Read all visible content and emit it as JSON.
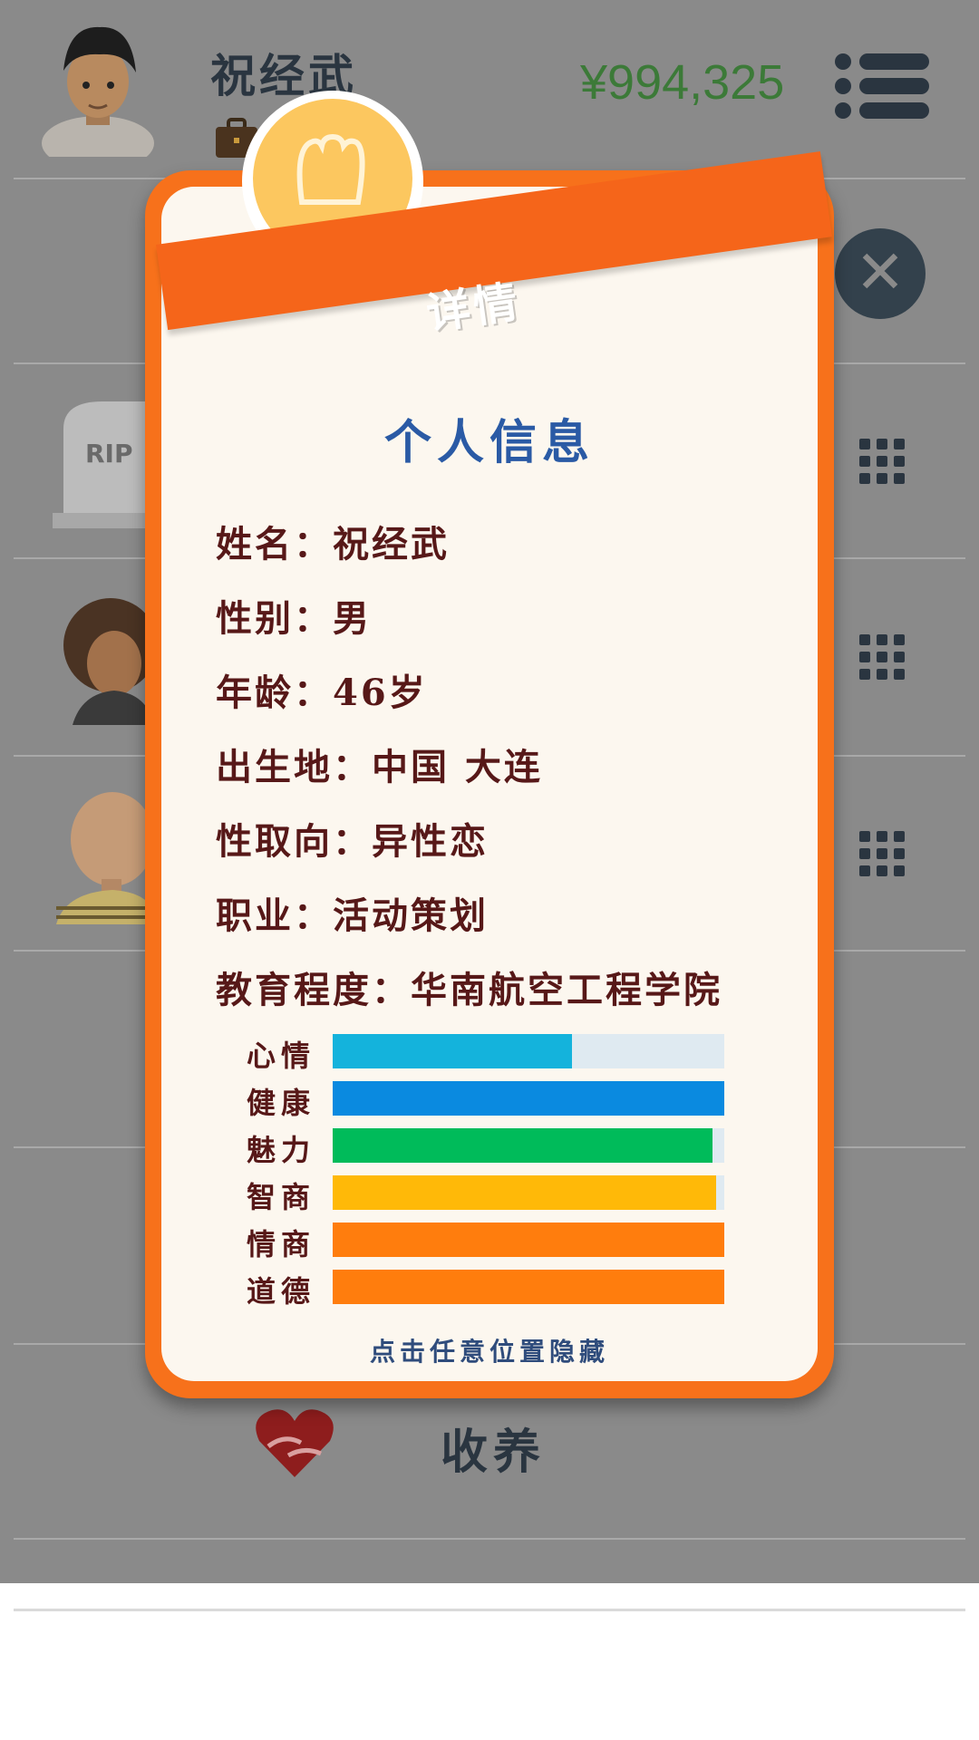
{
  "player": {
    "name": "祝经武",
    "money": "¥994,325"
  },
  "popup": {
    "ribbon_title": "详情",
    "section_title": "个人信息",
    "info": [
      {
        "label": "姓名：",
        "value": "祝经武"
      },
      {
        "label": "性别：",
        "value": "男"
      },
      {
        "label": "年龄：",
        "value": "46岁"
      },
      {
        "label": "出生地：",
        "value": "中国 大连"
      },
      {
        "label": "性取向：",
        "value": "异性恋"
      },
      {
        "label": "职业：",
        "value": "活动策划"
      },
      {
        "label": "教育程度：",
        "value": "华南航空工程学院"
      }
    ],
    "stats": [
      {
        "label": "心情",
        "value": 0.61,
        "color": "#14b3dc"
      },
      {
        "label": "健康",
        "value": 1.0,
        "color": "#0a8ae0"
      },
      {
        "label": "魅力",
        "value": 0.97,
        "color": "#00bb5a"
      },
      {
        "label": "智商",
        "value": 0.98,
        "color": "#ffb908"
      },
      {
        "label": "情商",
        "value": 1.0,
        "color": "#ff7d0d"
      },
      {
        "label": "道德",
        "value": 1.0,
        "color": "#ff7d0d"
      }
    ],
    "hint": "点击任意位置隐藏"
  },
  "rows": {
    "rip_text": "RIP",
    "adopt_label": "收养"
  },
  "icons": [
    "menu-icon",
    "briefcase-icon",
    "close-icon",
    "grid-icon",
    "lightbulb-icon",
    "heart-hands-icon",
    "rip-tombstone-icon"
  ]
}
